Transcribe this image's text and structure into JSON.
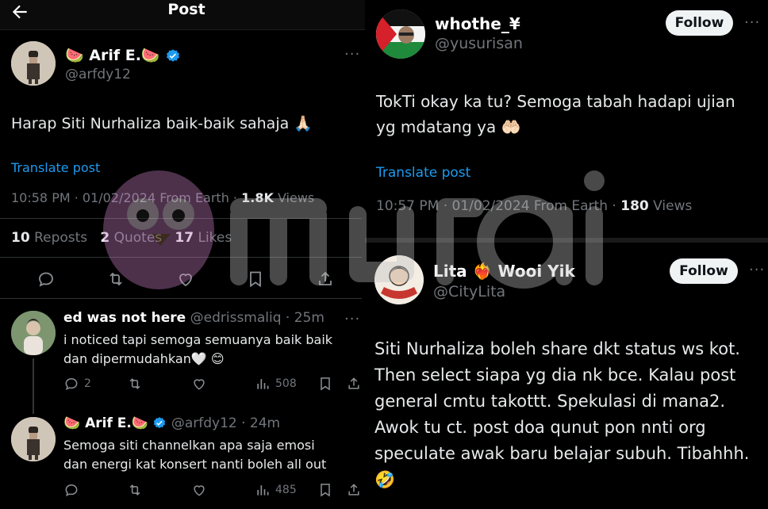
{
  "header": {
    "title": "Post"
  },
  "main_post": {
    "name": "🍉 Arif E.🍉",
    "handle": "@arfdy12",
    "text": "Harap Siti Nurhaliza baik-baik sahaja 🙏🏻",
    "translate": "Translate post",
    "meta_time": "10:58 PM · 01/02/2024 From Earth · ",
    "views_count": "1.8K",
    "views_label": " Views",
    "reposts_count": "10",
    "reposts_label": " Reposts",
    "quotes_count": "2",
    "quotes_label": " Quotes",
    "likes_count": "17",
    "likes_label": " Likes"
  },
  "reply1": {
    "name": "ed was not here",
    "handle_time": "@edrissmaliq · 25m",
    "text_line1": "i noticed tapi semoga semuanya baik baik",
    "text_line2": "dan dipermudahkan🤍 😊",
    "replies": "2",
    "views": "508"
  },
  "reply2": {
    "name": "🍉 Arif E.🍉",
    "handle_time": "@arfdy12 · 24m",
    "text_line1": "Semoga siti channelkan apa saja emosi",
    "text_line2": "dan energi kat konsert nanti boleh all out",
    "views": "485"
  },
  "right_post1": {
    "name": "whothe_¥",
    "handle": "@yusurisan",
    "follow": "Follow",
    "text_line1": "TokTi okay ka tu? Semoga tabah hadapi ujian",
    "text_line2": "yg mdatang ya 🤲🏻",
    "translate": "Translate post",
    "meta_time": "10:57 PM · 01/02/2024 From Earth · ",
    "views_count": "180",
    "views_label": " Views"
  },
  "right_post2": {
    "name": "Lita ❤️‍🔥 Wooi Yik",
    "handle": "@CityLita",
    "follow": "Follow",
    "lines": [
      "Siti Nurhaliza boleh share dkt status ws kot.",
      "Then select siapa yg dia nk bce. Kalau post",
      "general cmtu takottt. Spekulasi di mana2.",
      "Awok tu ct. post doa qunut pon nnti org",
      "speculate awak baru belajar subuh. Tibahhh.",
      "🤣"
    ]
  },
  "watermark": {
    "text": "murai"
  }
}
